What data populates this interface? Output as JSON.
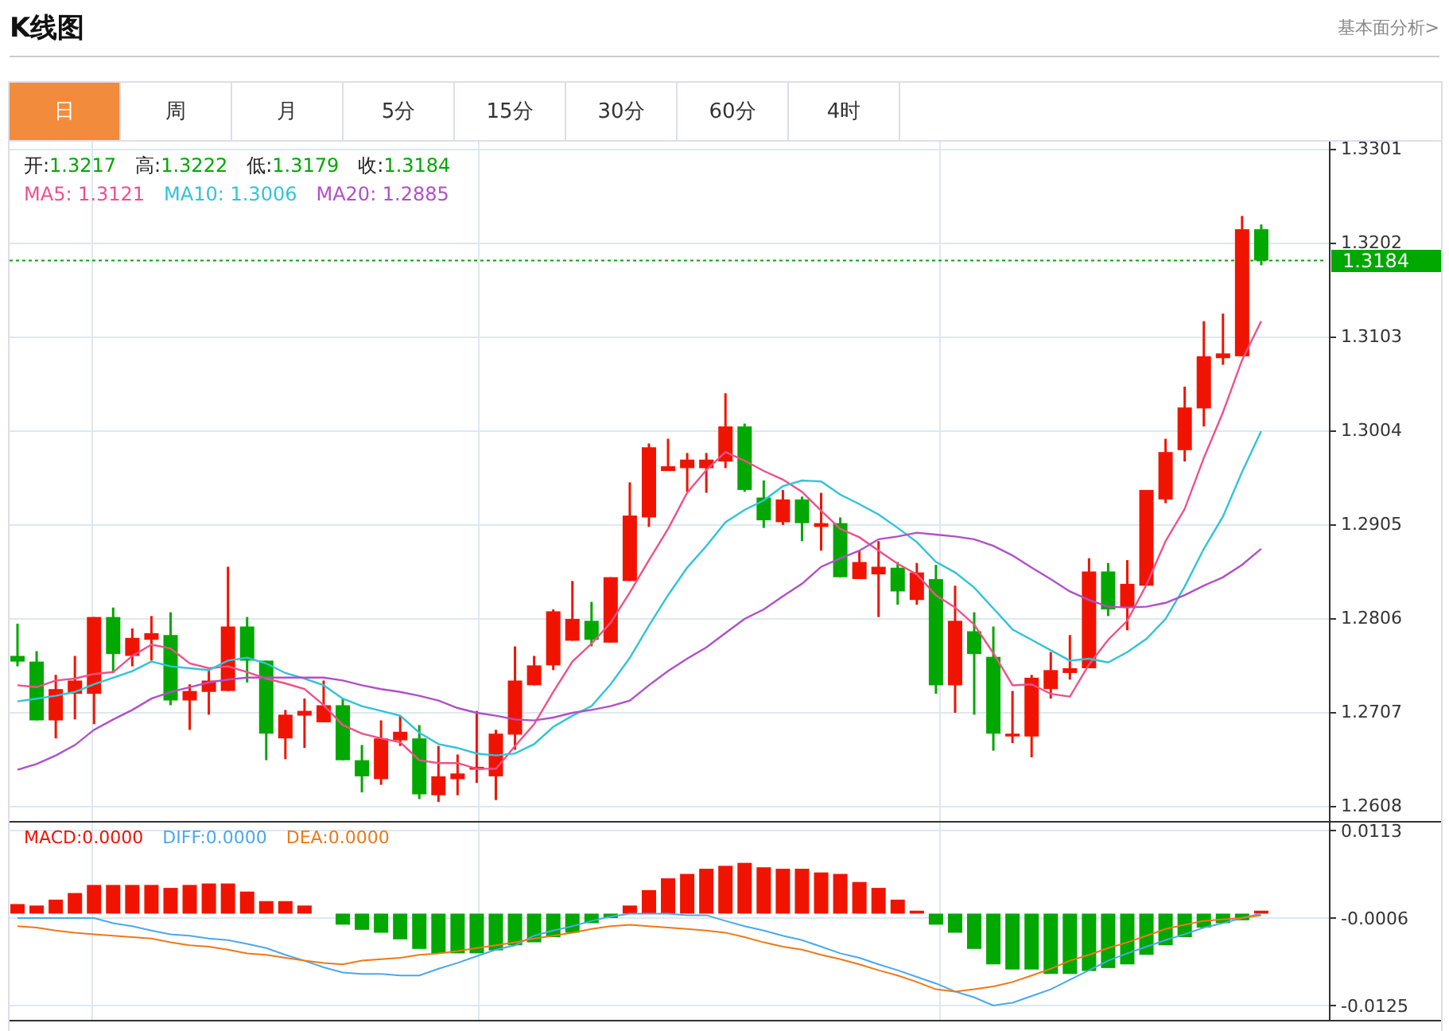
{
  "header": {
    "title": "K线图",
    "link": "基本面分析>"
  },
  "tabs": [
    {
      "label": "日",
      "selected": true
    },
    {
      "label": "周",
      "selected": false
    },
    {
      "label": "月",
      "selected": false
    },
    {
      "label": "5分",
      "selected": false
    },
    {
      "label": "15分",
      "selected": false
    },
    {
      "label": "30分",
      "selected": false
    },
    {
      "label": "60分",
      "selected": false
    },
    {
      "label": "4时",
      "selected": false
    }
  ],
  "price_chart": {
    "quote": [
      {
        "label": "开:",
        "value": "1.3217"
      },
      {
        "label": "高:",
        "value": "1.3222"
      },
      {
        "label": "低:",
        "value": "1.3179"
      },
      {
        "label": "收:",
        "value": "1.3184"
      }
    ],
    "ma_values": [
      "1.3121",
      "1.3006",
      "1.2885"
    ],
    "chart_data": {
      "type": "candlestick",
      "grid": true,
      "ylim": [
        1.2608,
        1.3301
      ],
      "yticks": [
        1.3301,
        1.3202,
        1.3103,
        1.3004,
        1.2905,
        1.2806,
        1.2707,
        1.2608
      ],
      "ref_lines": [
        {
          "axis": "y",
          "value": 1.3184,
          "label": "1.3184",
          "color": "#00a800"
        }
      ],
      "ohlc": [
        [
          1.2767,
          1.2801,
          1.2756,
          1.2761
        ],
        [
          1.2761,
          1.2772,
          1.2699,
          1.2699
        ],
        [
          1.2699,
          1.2747,
          1.268,
          1.2732
        ],
        [
          1.2727,
          1.2767,
          1.27,
          1.2741
        ],
        [
          1.2727,
          1.2808,
          1.2695,
          1.2808
        ],
        [
          1.2808,
          1.2818,
          1.2749,
          1.2769
        ],
        [
          1.2767,
          1.2796,
          1.2756,
          1.2786
        ],
        [
          1.2784,
          1.2809,
          1.2762,
          1.2791
        ],
        [
          1.2789,
          1.2813,
          1.2715,
          1.272
        ],
        [
          1.272,
          1.2737,
          1.2689,
          1.273
        ],
        [
          1.2729,
          1.2752,
          1.2705,
          1.2741
        ],
        [
          1.273,
          1.2861,
          1.273,
          1.2798
        ],
        [
          1.2798,
          1.2808,
          1.2739,
          1.2762
        ],
        [
          1.2762,
          1.2762,
          1.2657,
          1.2685
        ],
        [
          1.268,
          1.271,
          1.2658,
          1.2705
        ],
        [
          1.2704,
          1.2722,
          1.267,
          1.2709
        ],
        [
          1.2697,
          1.2741,
          1.2697,
          1.2715
        ],
        [
          1.2715,
          1.2722,
          1.2657,
          1.2657
        ],
        [
          1.2657,
          1.2673,
          1.2623,
          1.264
        ],
        [
          1.2637,
          1.2699,
          1.2631,
          1.268
        ],
        [
          1.2678,
          1.2704,
          1.2672,
          1.2687
        ],
        [
          1.268,
          1.2694,
          1.2616,
          1.2621
        ],
        [
          1.262,
          1.2672,
          1.2613,
          1.264
        ],
        [
          1.2637,
          1.2663,
          1.262,
          1.2643
        ],
        [
          1.2647,
          1.2709,
          1.2633,
          1.265
        ],
        [
          1.264,
          1.2689,
          1.2615,
          1.2685
        ],
        [
          1.2684,
          1.2777,
          1.2668,
          1.2741
        ],
        [
          1.2736,
          1.2767,
          1.2736,
          1.2757
        ],
        [
          1.2757,
          1.2816,
          1.2752,
          1.2814
        ],
        [
          1.2783,
          1.2846,
          1.2783,
          1.2806
        ],
        [
          1.2804,
          1.2824,
          1.2777,
          1.2784
        ],
        [
          1.2781,
          1.285,
          1.2781,
          1.285
        ],
        [
          1.2846,
          1.295,
          1.2846,
          1.2915
        ],
        [
          1.2913,
          1.2991,
          1.2903,
          1.2987
        ],
        [
          1.2962,
          1.2996,
          1.2962,
          1.2967
        ],
        [
          1.2965,
          1.2981,
          1.294,
          1.2974
        ],
        [
          1.2965,
          1.2981,
          1.2939,
          1.2974
        ],
        [
          1.2972,
          1.3044,
          1.2965,
          1.3009
        ],
        [
          1.3009,
          1.3012,
          1.294,
          1.2942
        ],
        [
          1.2934,
          1.2952,
          1.2902,
          1.291
        ],
        [
          1.2908,
          1.2942,
          1.2905,
          1.2932
        ],
        [
          1.2932,
          1.2935,
          1.2888,
          1.2907
        ],
        [
          1.2903,
          1.2939,
          1.2878,
          1.2907
        ],
        [
          1.2907,
          1.2913,
          1.285,
          1.285
        ],
        [
          1.2848,
          1.2878,
          1.2848,
          1.2866
        ],
        [
          1.2853,
          1.2888,
          1.2808,
          1.2861
        ],
        [
          1.286,
          1.2866,
          1.2821,
          1.2835
        ],
        [
          1.2826,
          1.2865,
          1.2821,
          1.2855
        ],
        [
          1.2848,
          1.2863,
          1.2727,
          1.2736
        ],
        [
          1.2736,
          1.2841,
          1.2707,
          1.2804
        ],
        [
          1.2793,
          1.2813,
          1.2705,
          1.2769
        ],
        [
          1.2766,
          1.2798,
          1.2667,
          1.2685
        ],
        [
          1.2682,
          1.273,
          1.2675,
          1.2685
        ],
        [
          1.2682,
          1.2747,
          1.266,
          1.2744
        ],
        [
          1.2732,
          1.2771,
          1.2722,
          1.2752
        ],
        [
          1.2749,
          1.2789,
          1.2742,
          1.2754
        ],
        [
          1.2754,
          1.287,
          1.2754,
          1.2856
        ],
        [
          1.2856,
          1.2865,
          1.2809,
          1.2816
        ],
        [
          1.2818,
          1.2868,
          1.2794,
          1.2843
        ],
        [
          1.2841,
          1.2942,
          1.2841,
          1.2942
        ],
        [
          1.2932,
          1.2996,
          1.2928,
          1.2982
        ],
        [
          1.2984,
          1.3051,
          1.2972,
          1.3029
        ],
        [
          1.3028,
          1.312,
          1.3009,
          1.3083
        ],
        [
          1.3081,
          1.3128,
          1.3074,
          1.3086
        ],
        [
          1.3083,
          1.3231,
          1.3083,
          1.3217
        ],
        [
          1.3217,
          1.3222,
          1.3179,
          1.3184
        ]
      ],
      "series": [
        {
          "name": "MA5:",
          "type": "line",
          "color": "#f0508c",
          "values": [
            1.2736,
            1.2734,
            1.2741,
            1.2743,
            1.2748,
            1.275,
            1.2767,
            1.2779,
            1.2775,
            1.2759,
            1.2754,
            1.2756,
            1.275,
            1.2743,
            1.2738,
            1.2732,
            1.2715,
            1.2694,
            1.2685,
            1.268,
            1.2676,
            1.2657,
            1.2654,
            1.2654,
            1.2648,
            1.2648,
            1.2672,
            1.2695,
            1.2729,
            1.2761,
            1.278,
            1.2802,
            1.2834,
            1.2868,
            1.2901,
            1.2939,
            1.2963,
            1.2982,
            1.2973,
            1.2962,
            1.2953,
            1.294,
            1.292,
            1.2901,
            1.2892,
            1.2878,
            1.2864,
            1.2853,
            1.2831,
            1.2818,
            1.28,
            1.277,
            1.2736,
            1.2737,
            1.2727,
            1.2724,
            1.2758,
            1.2784,
            1.2804,
            1.2842,
            1.2888,
            1.2922,
            1.2976,
            1.3024,
            1.3079,
            1.312
          ]
        },
        {
          "name": "MA10:",
          "type": "line",
          "color": "#30c4d8",
          "values": [
            1.2719,
            1.2722,
            1.2725,
            1.2729,
            1.2737,
            1.2744,
            1.2751,
            1.2761,
            1.2756,
            1.2754,
            1.2752,
            1.2762,
            1.2765,
            1.2759,
            1.2749,
            1.2743,
            1.2736,
            1.2722,
            1.2714,
            1.2709,
            1.2704,
            1.2686,
            1.2674,
            1.267,
            1.2664,
            1.2662,
            1.2664,
            1.2674,
            1.2692,
            1.2704,
            1.2714,
            1.2737,
            1.2765,
            1.2799,
            1.2831,
            1.286,
            1.2883,
            1.2908,
            1.2921,
            1.2931,
            1.2946,
            1.2952,
            1.2951,
            1.2937,
            1.2927,
            1.2916,
            1.2902,
            1.2887,
            1.2866,
            1.2855,
            1.2839,
            1.2817,
            1.2795,
            1.2784,
            1.2773,
            1.2762,
            1.2764,
            1.276,
            1.2771,
            1.2785,
            1.2806,
            1.284,
            1.288,
            1.2914,
            1.2961,
            1.3004
          ]
        },
        {
          "name": "MA20:",
          "type": "line",
          "color": "#b050c8",
          "values": [
            1.2647,
            1.2653,
            1.2662,
            1.2673,
            1.2689,
            1.27,
            1.271,
            1.2722,
            1.2729,
            1.2734,
            1.2739,
            1.2742,
            1.2744,
            1.2744,
            1.2744,
            1.2744,
            1.2744,
            1.2741,
            1.2736,
            1.2732,
            1.2729,
            1.2725,
            1.272,
            1.2712,
            1.2707,
            1.2704,
            1.27,
            1.2699,
            1.2702,
            1.2707,
            1.271,
            1.2714,
            1.272,
            1.2736,
            1.2751,
            1.2764,
            1.2776,
            1.2791,
            1.2806,
            1.2816,
            1.283,
            1.2843,
            1.2861,
            1.287,
            1.2878,
            1.289,
            1.2893,
            1.2897,
            1.2895,
            1.2893,
            1.289,
            1.2883,
            1.2873,
            1.286,
            1.2848,
            1.2835,
            1.2826,
            1.2819,
            1.2818,
            1.2819,
            1.2823,
            1.2831,
            1.2841,
            1.285,
            1.2863,
            1.288
          ]
        }
      ]
    }
  },
  "macd_chart": {
    "legend": [
      "0.0000",
      "0.0000",
      "0.0000"
    ],
    "chart_data": {
      "type": "bar",
      "grid": true,
      "ylim": [
        -0.0125,
        0.0113
      ],
      "yticks": [
        0.0113,
        -0.0006,
        -0.0125
      ],
      "series": [
        {
          "name": "MACD:",
          "type": "bar",
          "color": "#f01400",
          "values": [
            0.0013,
            0.0011,
            0.0019,
            0.0028,
            0.0039,
            0.0039,
            0.0039,
            0.0039,
            0.0035,
            0.0039,
            0.0041,
            0.0041,
            0.003,
            0.0017,
            0.0017,
            0.0011,
            null,
            null,
            null,
            null,
            null,
            null,
            null,
            null,
            null,
            null,
            null,
            null,
            null,
            null,
            null,
            null,
            0.0011,
            0.0032,
            0.0048,
            0.0054,
            0.0061,
            0.0065,
            0.0069,
            0.0063,
            0.0061,
            0.0061,
            0.0056,
            0.0054,
            0.0043,
            0.0035,
            0.0019,
            0.0004,
            null,
            null,
            null,
            null,
            null,
            null,
            null,
            null,
            null,
            null,
            null,
            null,
            null,
            null,
            null,
            null,
            null,
            0.0004
          ]
        },
        {
          "name": "DIFF:",
          "type": "line",
          "color": "#4aa8f0",
          "values": [
            -0.0006,
            -0.0006,
            -0.0006,
            -0.0006,
            -0.0006,
            -0.0013,
            -0.0017,
            -0.0023,
            -0.0028,
            -0.003,
            -0.0034,
            -0.0036,
            -0.0041,
            -0.0047,
            -0.0056,
            -0.0064,
            -0.0073,
            -0.008,
            -0.0082,
            -0.0082,
            -0.0084,
            -0.0084,
            -0.0075,
            -0.0067,
            -0.0058,
            -0.0049,
            -0.0043,
            -0.003,
            -0.0023,
            -0.0017,
            -0.001,
            -0.0004,
            0.0,
            0.0,
            0.0,
            -0.0002,
            -0.0002,
            -0.001,
            -0.0017,
            -0.0023,
            -0.003,
            -0.0036,
            -0.0045,
            -0.0054,
            -0.006,
            -0.0069,
            -0.0077,
            -0.0086,
            -0.0095,
            -0.0106,
            -0.0114,
            -0.0125,
            -0.0121,
            -0.0112,
            -0.0103,
            -0.009,
            -0.0077,
            -0.0064,
            -0.0054,
            -0.0045,
            -0.0036,
            -0.0028,
            -0.0019,
            -0.0013,
            -0.0006,
            0.0
          ]
        },
        {
          "name": "DEA:",
          "type": "line",
          "color": "#f07818",
          "values": [
            -0.0017,
            -0.0019,
            -0.0023,
            -0.0026,
            -0.0028,
            -0.003,
            -0.0032,
            -0.0034,
            -0.0039,
            -0.0043,
            -0.0045,
            -0.0049,
            -0.0054,
            -0.0056,
            -0.006,
            -0.0064,
            -0.0067,
            -0.0069,
            -0.0064,
            -0.0062,
            -0.006,
            -0.0056,
            -0.0054,
            -0.0051,
            -0.0047,
            -0.0043,
            -0.0039,
            -0.0034,
            -0.003,
            -0.0026,
            -0.0021,
            -0.0017,
            -0.0015,
            -0.0017,
            -0.0019,
            -0.0021,
            -0.0023,
            -0.0026,
            -0.0032,
            -0.0039,
            -0.0045,
            -0.0049,
            -0.0056,
            -0.0062,
            -0.0069,
            -0.0077,
            -0.0084,
            -0.0093,
            -0.0103,
            -0.0106,
            -0.0103,
            -0.0099,
            -0.0093,
            -0.0084,
            -0.0075,
            -0.0064,
            -0.0056,
            -0.0047,
            -0.0039,
            -0.003,
            -0.0021,
            -0.0015,
            -0.001,
            -0.0008,
            -0.0006,
            -0.0002
          ]
        },
        {
          "type": "bar",
          "color": "#00a800",
          "values": [
            null,
            null,
            null,
            null,
            null,
            null,
            null,
            null,
            null,
            null,
            null,
            null,
            null,
            null,
            null,
            null,
            null,
            -0.0015,
            -0.0022,
            -0.0026,
            -0.0035,
            -0.0048,
            -0.0054,
            -0.0054,
            -0.0054,
            -0.005,
            -0.0043,
            -0.0039,
            -0.0032,
            -0.0026,
            -0.0013,
            -0.0006,
            null,
            null,
            null,
            null,
            null,
            null,
            null,
            null,
            null,
            null,
            null,
            null,
            null,
            null,
            null,
            null,
            -0.0015,
            -0.0026,
            -0.0048,
            -0.0069,
            -0.0076,
            -0.0076,
            -0.0082,
            -0.0082,
            -0.0078,
            -0.0074,
            -0.0069,
            -0.0056,
            -0.0043,
            -0.0032,
            -0.0019,
            -0.0013,
            -0.0009,
            null
          ]
        }
      ]
    }
  }
}
